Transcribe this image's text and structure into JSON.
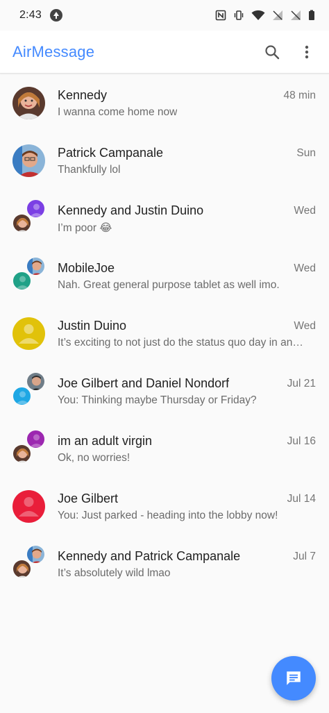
{
  "status_bar": {
    "time": "2:43",
    "icons": [
      "upload-icon",
      "nfc-icon",
      "vibrate-icon",
      "wifi-icon",
      "no-signal-icon",
      "no-signal-icon",
      "battery-icon"
    ]
  },
  "app_bar": {
    "title": "AirMessage",
    "title_color": "#448aff",
    "actions": [
      "search-icon",
      "more-vert-icon"
    ]
  },
  "conversations": [
    {
      "title": "Kennedy",
      "preview": "I wanna come home now",
      "time": "48 min",
      "avatar": "photo"
    },
    {
      "title": "Patrick Campanale",
      "preview": "Thankfully lol",
      "time": "Sun",
      "avatar": "photo"
    },
    {
      "title": "Kennedy and Justin Duino",
      "preview": "I’m poor 😂",
      "time": "Wed",
      "avatar": "group",
      "group_colors": [
        "#7b3fe4",
        "photo"
      ]
    },
    {
      "title": "MobileJoe",
      "preview": "Nah. Great general purpose tablet as well imo.",
      "time": "Wed",
      "avatar": "group",
      "group_colors": [
        "photo",
        "#1fa187"
      ]
    },
    {
      "title": "Justin Duino",
      "preview": "It’s exciting to not just do the status quo day in an…",
      "time": "Wed",
      "avatar": "placeholder",
      "color": "#e1c20a"
    },
    {
      "title": "Joe Gilbert and Daniel Nondorf",
      "preview": "You: Thinking maybe Thursday or Friday?",
      "time": "Jul 21",
      "avatar": "group",
      "group_colors": [
        "photo",
        "#1ea7e4"
      ]
    },
    {
      "title": "im an adult virgin",
      "preview": "Ok, no worries!",
      "time": "Jul 16",
      "avatar": "group",
      "group_colors": [
        "#9c27b0",
        "photo"
      ]
    },
    {
      "title": "Joe Gilbert",
      "preview": "You: Just parked - heading into the lobby now!",
      "time": "Jul 14",
      "avatar": "placeholder",
      "color": "#e91e3a"
    },
    {
      "title": "Kennedy and Patrick Campanale",
      "preview": "It’s absolutely wild lmao",
      "time": "Jul 7",
      "avatar": "group",
      "group_colors": [
        "photo",
        "photo"
      ]
    }
  ],
  "fab": {
    "icon": "new-message-icon",
    "color": "#448aff"
  }
}
